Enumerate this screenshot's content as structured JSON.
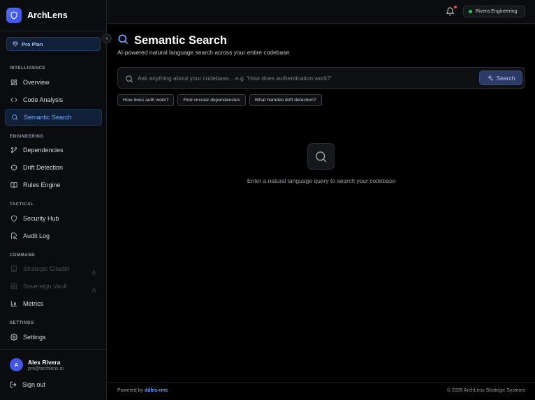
{
  "app": {
    "name": "ArchLens",
    "logo_icon": "shield-icon"
  },
  "plan": {
    "label": "Pro Plan",
    "icon": "diamond-icon"
  },
  "sidebar": {
    "sections": [
      {
        "title": "INTELLIGENCE",
        "items": [
          {
            "label": "Overview",
            "icon": "grid-icon"
          },
          {
            "label": "Code Analysis",
            "icon": "code-icon"
          },
          {
            "label": "Semantic Search",
            "icon": "search-icon",
            "active": true
          }
        ]
      },
      {
        "title": "ENGINEERING",
        "items": [
          {
            "label": "Dependencies",
            "icon": "git-branch-icon"
          },
          {
            "label": "Drift Detection",
            "icon": "crosshair-icon"
          },
          {
            "label": "Rules Engine",
            "icon": "book-icon"
          }
        ]
      },
      {
        "title": "TACTICAL",
        "items": [
          {
            "label": "Security Hub",
            "icon": "shield-icon"
          },
          {
            "label": "Audit Log",
            "icon": "file-search-icon"
          }
        ]
      },
      {
        "title": "COMMAND",
        "items": [
          {
            "label": "Strategic Citadel",
            "icon": "building-icon",
            "locked": true
          },
          {
            "label": "Sovereign Vault",
            "icon": "vault-icon",
            "locked": true
          },
          {
            "label": "Metrics",
            "icon": "bar-chart-icon"
          }
        ]
      },
      {
        "title": "SETTINGS",
        "items": [
          {
            "label": "Settings",
            "icon": "gear-icon"
          }
        ]
      }
    ]
  },
  "user": {
    "initial": "A",
    "name": "Alex Rivera",
    "email": "pro@archlens.io"
  },
  "signout": {
    "label": "Sign out"
  },
  "topbar": {
    "org": "Rivera Engineering",
    "notification_dot": true
  },
  "main": {
    "title": "Semantic Search",
    "subtitle": "AI-powered natural language search across your entire codebase",
    "search": {
      "placeholder": "Ask anything about your codebase... e.g. 'How does authentication work?'",
      "value": "",
      "button_label": "Search"
    },
    "suggestions": [
      "How does auth work?",
      "Find circular dependencies",
      "What handles drift detection?"
    ],
    "empty_state": "Enter a natural language query to search your codebase"
  },
  "footer": {
    "powered_prefix": "Powered by",
    "powered_brand": "ddbis-rmc",
    "copyright": "© 2026 ArchLens Strategic Systems"
  },
  "colors": {
    "accent": "#4f6bff",
    "active_text": "#7fb0ff",
    "background": "#000000",
    "sidebar": "#0b0c0f",
    "status_online": "#22c55e",
    "notification": "#ef4444"
  }
}
